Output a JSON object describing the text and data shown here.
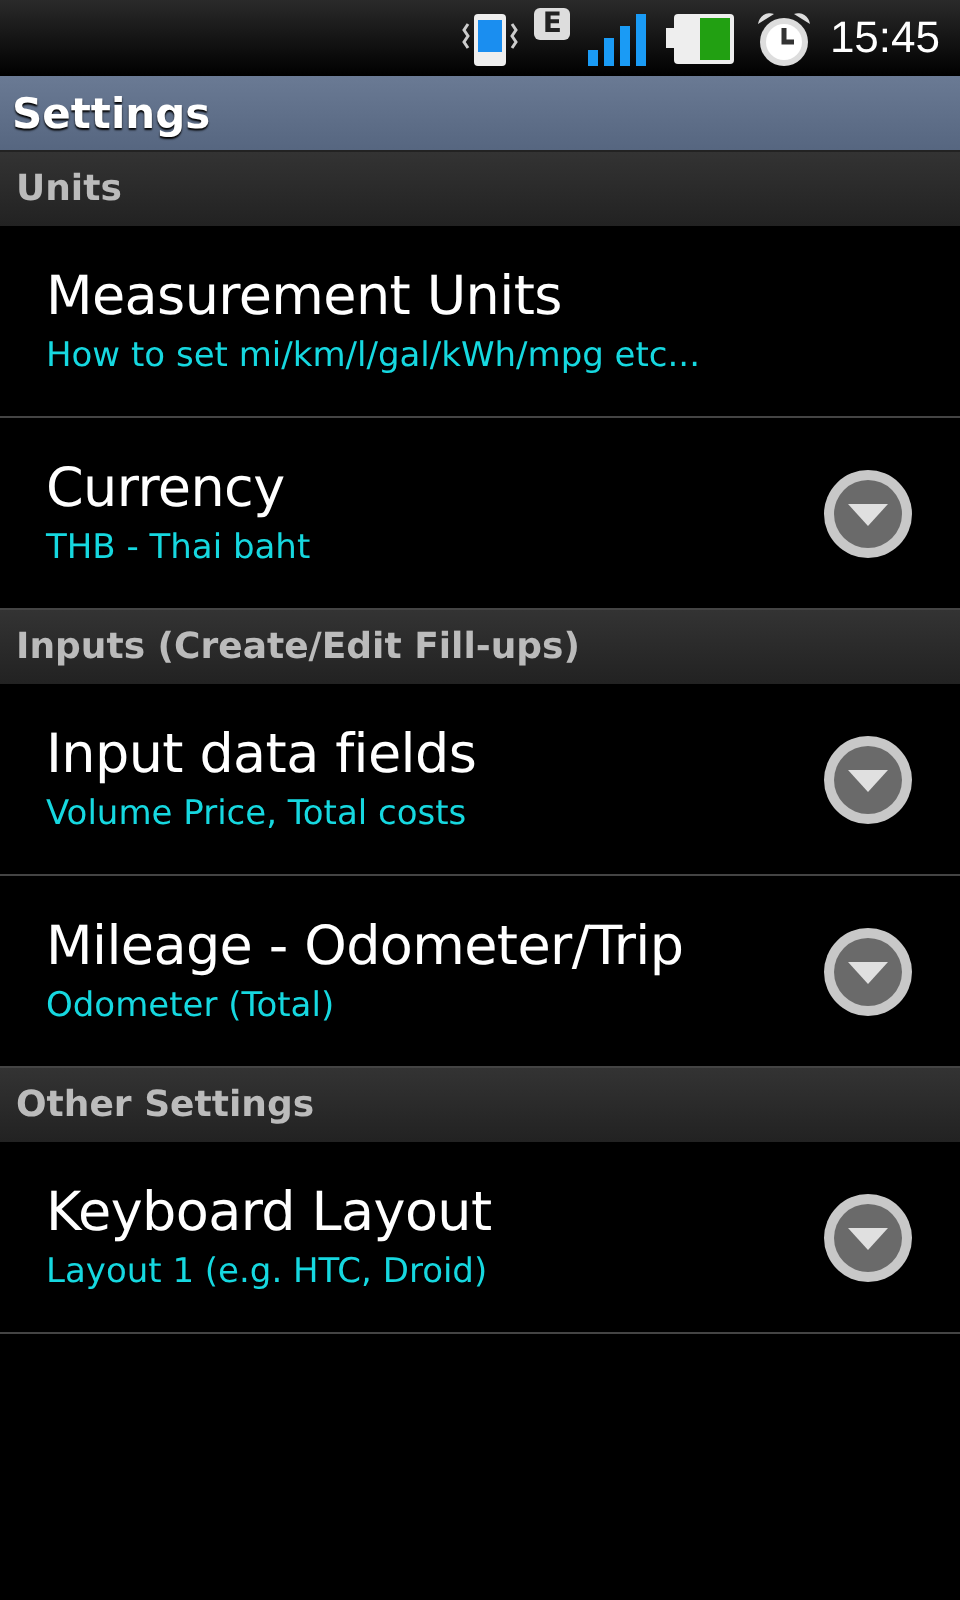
{
  "status_bar": {
    "network": "E",
    "time": "15:45"
  },
  "title": "Settings",
  "sections": [
    {
      "header": "Units",
      "items": [
        {
          "kind": "plain",
          "title": "Measurement Units",
          "summary": "How to set mi/km/l/gal/kWh/mpg etc..."
        },
        {
          "kind": "dropdown",
          "title": "Currency",
          "summary": "THB - Thai baht"
        }
      ]
    },
    {
      "header": "Inputs (Create/Edit Fill-ups)",
      "items": [
        {
          "kind": "dropdown",
          "title": "Input data fields",
          "summary": "Volume Price, Total costs"
        },
        {
          "kind": "dropdown",
          "title": "Mileage - Odometer/Trip",
          "summary": "Odometer (Total)"
        }
      ]
    },
    {
      "header": "Other Settings",
      "items": [
        {
          "kind": "dropdown",
          "title": "Keyboard Layout",
          "summary": "Layout 1 (e.g. HTC, Droid)"
        }
      ]
    }
  ]
}
